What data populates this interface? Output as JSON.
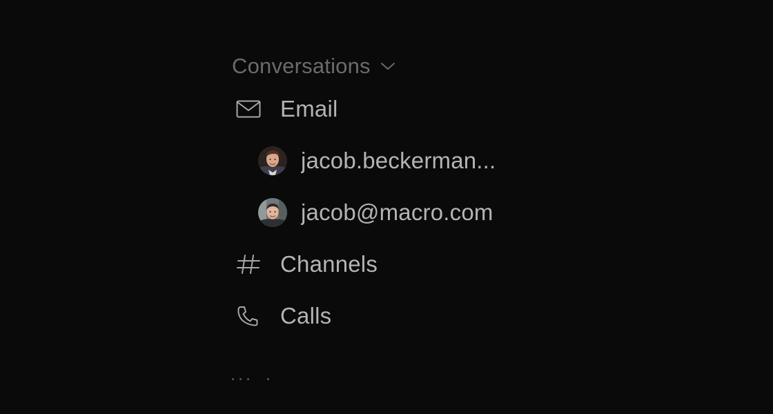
{
  "conversations": {
    "header_label": "Conversations",
    "chevron_icon": "chevron-down-icon",
    "items": [
      {
        "label": "Email",
        "icon": "mail-icon"
      },
      {
        "label": "jacob.beckerman...",
        "icon": "avatar"
      },
      {
        "label": "jacob@macro.com",
        "icon": "avatar"
      },
      {
        "label": "Channels",
        "icon": "hash-icon"
      },
      {
        "label": "Calls",
        "icon": "phone-icon"
      }
    ]
  },
  "colors": {
    "background": "#0a0a0a",
    "header_text": "#6b6b6b",
    "item_text": "#b4b4b4",
    "icon_stroke": "#a8a8a8"
  }
}
